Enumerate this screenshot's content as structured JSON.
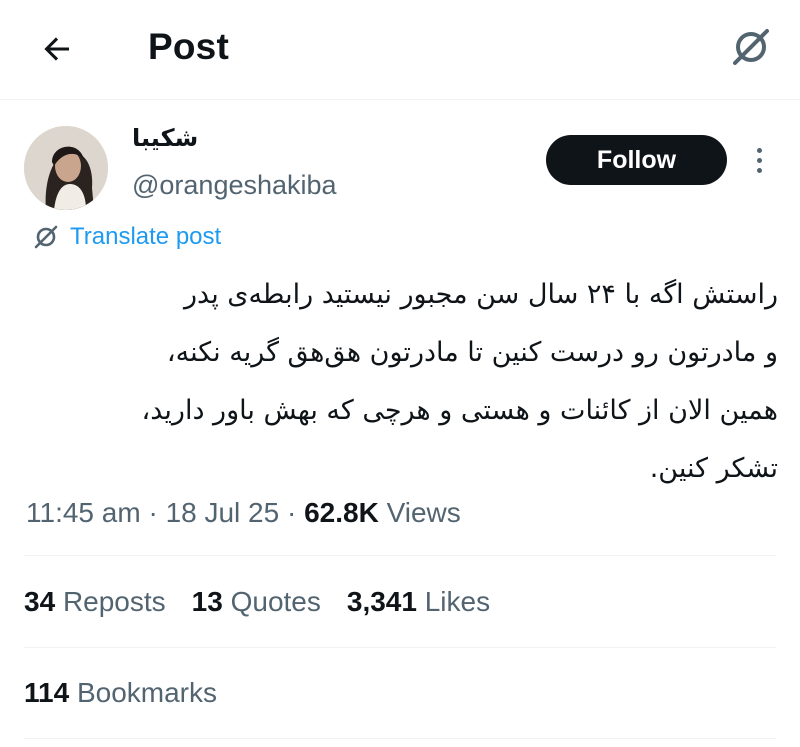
{
  "header": {
    "title": "Post",
    "back_icon": "arrow-left-icon",
    "translate_icon": "translate-icon"
  },
  "author": {
    "display_name": "شکیبا",
    "handle": "@orangeshakiba",
    "avatar": "profile-photo"
  },
  "actions": {
    "follow_label": "Follow",
    "more_icon": "more-vertical-icon"
  },
  "translate": {
    "label": "Translate post",
    "icon": "translate-icon"
  },
  "tweet": {
    "lines": [
      "راستش اگه با ۲۴ سال سن مجبور نیستید رابطه‌ی پدر",
      "و مادرتون رو درست کنین تا مادرتون هق‌هق گریه نکنه،",
      "همین الان از کائنات و هستی و هرچی که بهش باور دارید،",
      "تشکر کنین."
    ]
  },
  "meta": {
    "time": "11:45 am",
    "sep1": " · ",
    "date": "18 Jul 25",
    "sep2": " · ",
    "views_count": "62.8K",
    "views_label": "Views"
  },
  "stats": {
    "reposts_count": "34",
    "reposts_label": "Reposts",
    "quotes_count": "13",
    "quotes_label": "Quotes",
    "likes_count": "3,341",
    "likes_label": "Likes",
    "bookmarks_count": "114",
    "bookmarks_label": "Bookmarks"
  },
  "colors": {
    "text": "#0f1419",
    "secondary": "#536471",
    "link": "#1d9bf0",
    "button_bg": "#0f1419",
    "border": "#eff3f4"
  }
}
